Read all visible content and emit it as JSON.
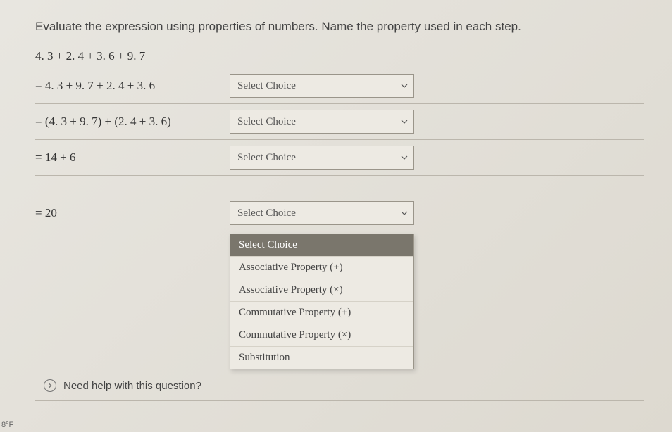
{
  "question": "Evaluate the expression using properties of numbers. Name the property used in each step.",
  "initial_expression": "4. 3 + 2. 4 + 3. 6 + 9. 7",
  "steps": [
    {
      "expr": "= 4. 3 + 9. 7 + 2. 4 + 3. 6",
      "placeholder": "Select Choice"
    },
    {
      "expr": "= (4. 3 + 9. 7) + (2. 4 + 3. 6)",
      "placeholder": "Select Choice"
    },
    {
      "expr": "= 14 + 6",
      "placeholder": "Select Choice"
    },
    {
      "expr": "= 20",
      "placeholder": "Select Choice"
    }
  ],
  "dropdown_options": [
    "Select Choice",
    "Associative Property (+)",
    "Associative Property (×)",
    "Commutative Property (+)",
    "Commutative Property (×)",
    "Substitution"
  ],
  "help_text": "Need help with this question?",
  "temp": "8°F"
}
